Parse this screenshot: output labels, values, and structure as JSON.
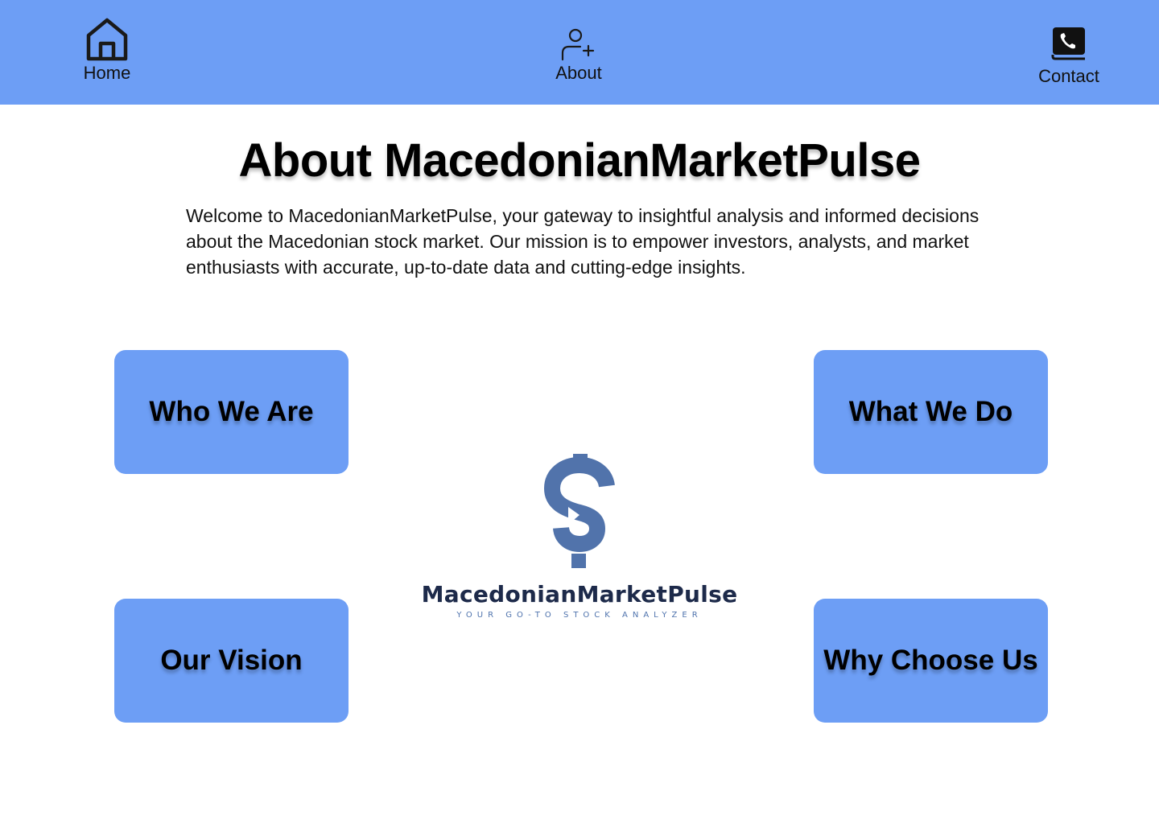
{
  "nav": {
    "home": {
      "label": "Home",
      "icon": "home-icon"
    },
    "about": {
      "label": "About",
      "icon": "add-user-icon"
    },
    "contact": {
      "label": "Contact",
      "icon": "contact-book-icon"
    }
  },
  "main": {
    "title": "About MacedonianMarketPulse",
    "intro": "Welcome to MacedonianMarketPulse, your gateway to insightful analysis and informed decisions about the Macedonian stock market. Our mission is to empower investors, analysts, and market enthusiasts with accurate, up-to-date data and cutting-edge insights.",
    "cards": [
      {
        "label": "Who We Are"
      },
      {
        "label": "What We Do"
      },
      {
        "label": "Our Vision"
      },
      {
        "label": "Why Choose Us"
      }
    ]
  },
  "logo": {
    "name": "MacedonianMarketPulse",
    "tagline": "YOUR GO-TO STOCK ANALYZER",
    "icon": "dollar-sign-icon"
  },
  "colors": {
    "accent": "#6d9ef5",
    "logo_dark": "#1d2a4a",
    "logo_blue": "#4f73ad"
  }
}
